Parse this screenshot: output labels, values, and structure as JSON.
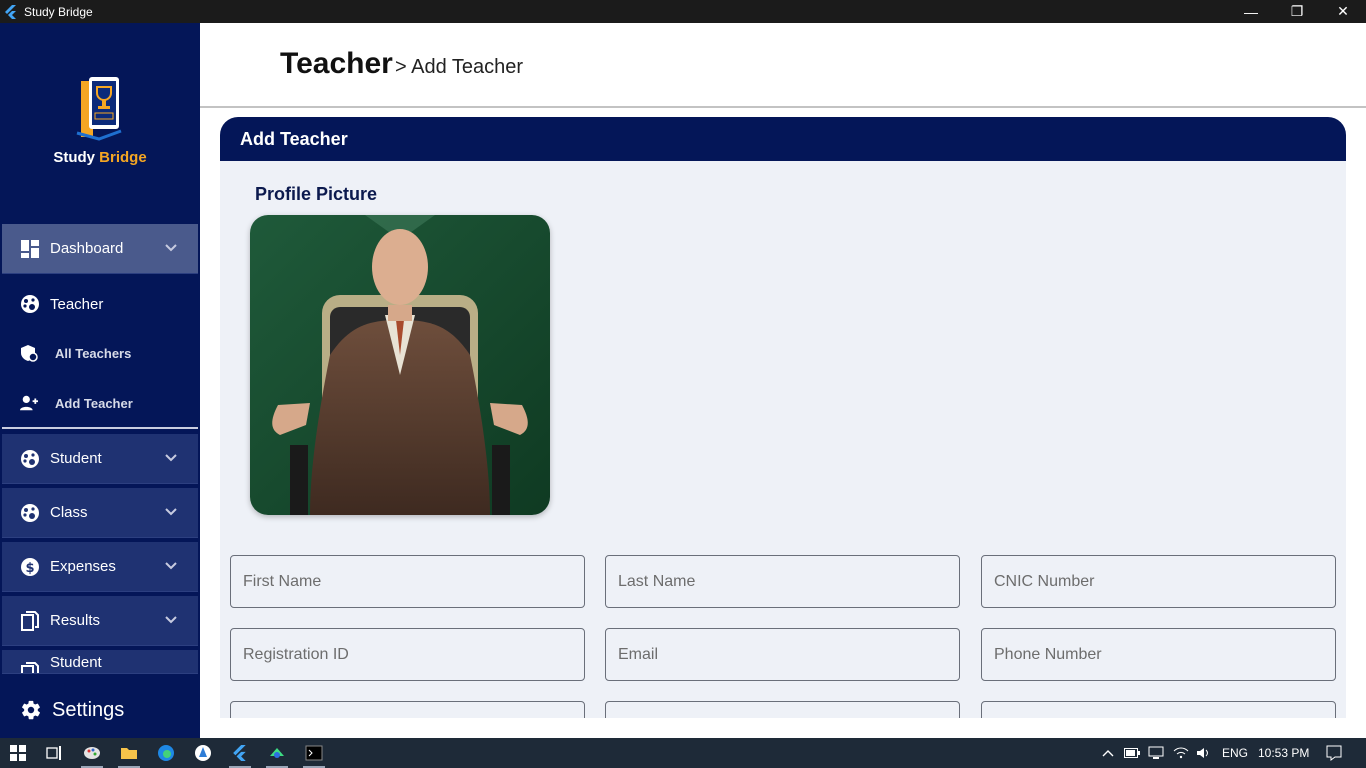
{
  "window": {
    "title": "Study Bridge"
  },
  "brand": {
    "name_part1": "Study",
    "name_part2": "Bridge",
    "accent_color": "#f5a623",
    "sidebar_color": "#041658"
  },
  "sidebar": {
    "items": [
      {
        "label": "Dashboard",
        "icon": "dashboard-icon"
      },
      {
        "label": "Teacher",
        "icon": "teacher-icon"
      },
      {
        "label": "All Teachers",
        "icon": "teachers-list-icon"
      },
      {
        "label": "Add Teacher",
        "icon": "add-person-icon"
      },
      {
        "label": "Student",
        "icon": "student-icon"
      },
      {
        "label": "Class",
        "icon": "class-icon"
      },
      {
        "label": "Expenses",
        "icon": "dollar-icon"
      },
      {
        "label": "Results",
        "icon": "documents-icon"
      },
      {
        "label": "Student",
        "icon": "documents-icon"
      }
    ],
    "settings_label": "Settings"
  },
  "header": {
    "crumb_main": "Teacher",
    "crumb_rest": "> Add Teacher"
  },
  "card": {
    "title": "Add Teacher",
    "profile_label": "Profile Picture"
  },
  "form": {
    "first_name": "First Name",
    "last_name": "Last Name",
    "cnic": "CNIC Number",
    "registration_id": "Registration ID",
    "email": "Email",
    "phone": "Phone Number"
  },
  "taskbar": {
    "lang": "ENG",
    "time": "10:53 PM"
  }
}
